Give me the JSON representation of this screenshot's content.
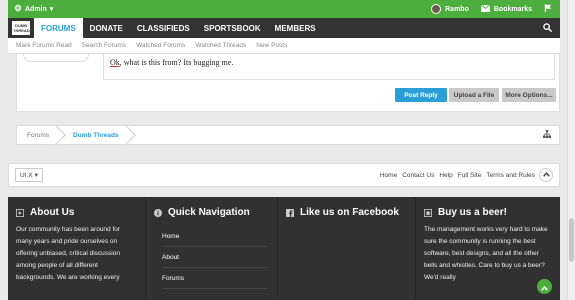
{
  "adminbar": {
    "admin_label": "Admin",
    "username": "Rambo",
    "bookmarks_label": "Bookmarks"
  },
  "nav": {
    "logo": "DUMB THREADS",
    "tabs": [
      {
        "label": "FORUMS",
        "active": true
      },
      {
        "label": "DONATE"
      },
      {
        "label": "CLASSIFIEDS"
      },
      {
        "label": "SPORTSBOOK"
      },
      {
        "label": "MEMBERS"
      }
    ]
  },
  "subnav": {
    "items": [
      "Mark Forums Read",
      "Search Forums",
      "Watched Forums",
      "Watched Threads",
      "New Posts"
    ]
  },
  "editor": {
    "text_underlined": "Ok",
    "text_rest": ", what is this from?  Its bugging me."
  },
  "buttons": {
    "post_reply": "Post Reply",
    "upload": "Upload a File",
    "more": "More Options..."
  },
  "breadcrumb": {
    "items": [
      "Forums",
      "Dumb Threads"
    ]
  },
  "footer_bar": {
    "style": "UI.X",
    "links": [
      "Home",
      "Contact Us",
      "Help",
      "Full Site",
      "Terms and Rules"
    ]
  },
  "footer": {
    "about": {
      "title": "About Us",
      "text": "Our community has been around for many years and pride ourselves on offering unbiased, critical discussion among people of all different backgrounds. We are working every"
    },
    "quicknav": {
      "title": "Quick Navigation",
      "items": [
        "Home",
        "About",
        "Forums"
      ]
    },
    "facebook": {
      "title": "Like us on Facebook"
    },
    "beer": {
      "title": "Buy us a beer!",
      "text": "The management works very hard to make sure the community is running the best software, best designs, and all the other bells and whistles. Care to buy us a beer? We'd really"
    }
  },
  "colors": {
    "accent": "#2a9fd6",
    "admin_green": "#4cae3c",
    "nav_dark": "#333333",
    "footer_dark": "#313131"
  }
}
